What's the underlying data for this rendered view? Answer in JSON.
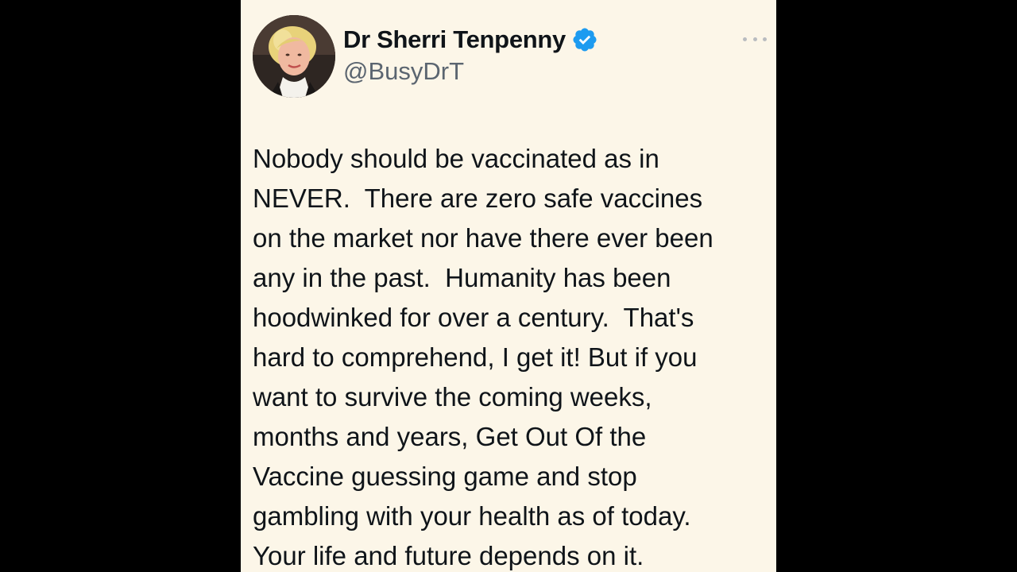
{
  "tweet": {
    "author": {
      "display_name": "Dr Sherri Tenpenny",
      "handle": "@BusyDrT",
      "verified": true,
      "verified_badge_color": "#1d9bf0",
      "avatar_icon": "profile-photo"
    },
    "more_icon": "ellipsis-icon",
    "text_lines": [
      "Nobody should be vaccinated as in",
      "NEVER.  There are zero safe vaccines",
      "on the market nor have there ever been",
      "any in the past.  Humanity has been",
      "hoodwinked for over a century.  That's",
      "hard to comprehend, I get it! But if you",
      "want to survive the coming weeks,",
      "months and years, Get Out Of the",
      "Vaccine guessing game and stop",
      "gambling with your health as of today.",
      "Your life and future depends on it."
    ]
  },
  "colors": {
    "page_background": "#000000",
    "card_background": "#fcf6e8",
    "text": "#0f1419",
    "handle_text": "#5b6570"
  }
}
